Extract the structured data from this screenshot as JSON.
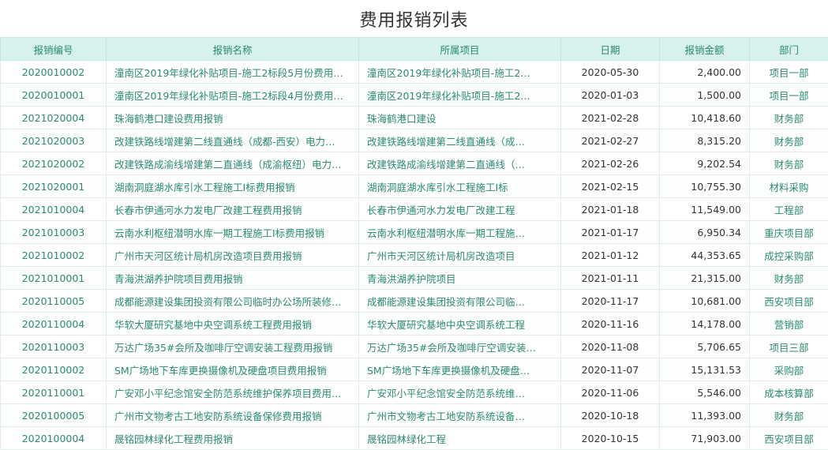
{
  "title": "费用报销列表",
  "chart_data": {
    "type": "table",
    "columns": [
      "报销编号",
      "报销名称",
      "所属项目",
      "日期",
      "报销金额",
      "部门"
    ],
    "rows": [
      [
        "2020010002",
        "潼南区2019年绿化补贴项目-施工2标段5月份费用…",
        "潼南区2019年绿化补贴项目-施工2…",
        "2020-05-30",
        "2,400.00",
        "项目一部"
      ],
      [
        "2020010001",
        "潼南区2019年绿化补贴项目-施工2标段4月份费用…",
        "潼南区2019年绿化补贴项目-施工2…",
        "2020-01-03",
        "1,500.00",
        "项目一部"
      ],
      [
        "2021020004",
        "珠海鹤港口建设费用报销",
        "珠海鹤港口建设",
        "2021-02-28",
        "10,418.60",
        "财务部"
      ],
      [
        "2021020003",
        "改建铁路线增建第二线直通线（成都-西安）电力…",
        "改建铁路线增建第二线直通线（成…",
        "2021-02-27",
        "8,315.20",
        "财务部"
      ],
      [
        "2021020002",
        "改建铁路成渝线增建第二直通线（成渝枢纽）电力…",
        "改建铁路成渝线增建第二直通线（…",
        "2021-02-26",
        "9,202.54",
        "财务部"
      ],
      [
        "2021020001",
        "湖南洞庭湖水库引水工程施工I标费用报销",
        "湖南洞庭湖水库引水工程施工I标",
        "2021-02-15",
        "10,755.30",
        "材料采购"
      ],
      [
        "2021010004",
        "长春市伊通河水力发电厂改建工程费用报销",
        "长春市伊通河水力发电厂改建工程",
        "2021-01-18",
        "11,549.00",
        "工程部"
      ],
      [
        "2021010003",
        "云南水利枢纽潜明水库一期工程施工I标费用报销",
        "云南水利枢纽潜明水库一期工程施…",
        "2021-01-17",
        "6,950.34",
        "重庆项目部"
      ],
      [
        "2021010002",
        "广州市天河区统计局机房改造项目费用报销",
        "广州市天河区统计局机房改造项目",
        "2021-01-12",
        "44,353.65",
        "成控采购部"
      ],
      [
        "2021010001",
        "青海洪湖养护院项目费用报销",
        "青海洪湖养护院项目",
        "2021-01-11",
        "21,315.00",
        "财务部"
      ],
      [
        "2020110005",
        "成都能源建设集团投资有限公司临时办公场所装修…",
        "成都能源建设集团投资有限公司临…",
        "2020-11-17",
        "10,681.00",
        "西安项目部"
      ],
      [
        "2020110004",
        "华软大厦研究基地中央空调系统工程费用报销",
        "华软大厦研究基地中央空调系统工程",
        "2020-11-16",
        "14,178.00",
        "营销部"
      ],
      [
        "2020110003",
        "万达广场35#会所及咖啡厅空调安装工程费用报销",
        "万达广场35#会所及咖啡厅空调安装…",
        "2020-11-08",
        "5,706.65",
        "项目三部"
      ],
      [
        "2020110002",
        "SM广场地下车库更换摄像机及硬盘项目费用报销",
        "SM广场地下车库更换摄像机及硬盘…",
        "2020-11-07",
        "15,131.53",
        "采购部"
      ],
      [
        "2020110001",
        "广安邓小平纪念馆安全防范系统维护保养项目费用…",
        "广安邓小平纪念馆安全防范系统维…",
        "2020-11-06",
        "5,546.00",
        "成本核算部"
      ],
      [
        "2020100005",
        "广州市文物考古工地安防系统设备保修费用报销",
        "广州市文物考古工地安防系统设备…",
        "2020-10-18",
        "11,393.00",
        "财务部"
      ],
      [
        "2020100004",
        "晟铭园林绿化工程费用报销",
        "晟铭园林绿化工程",
        "2020-10-15",
        "71,903.00",
        "西安项目部"
      ]
    ]
  }
}
